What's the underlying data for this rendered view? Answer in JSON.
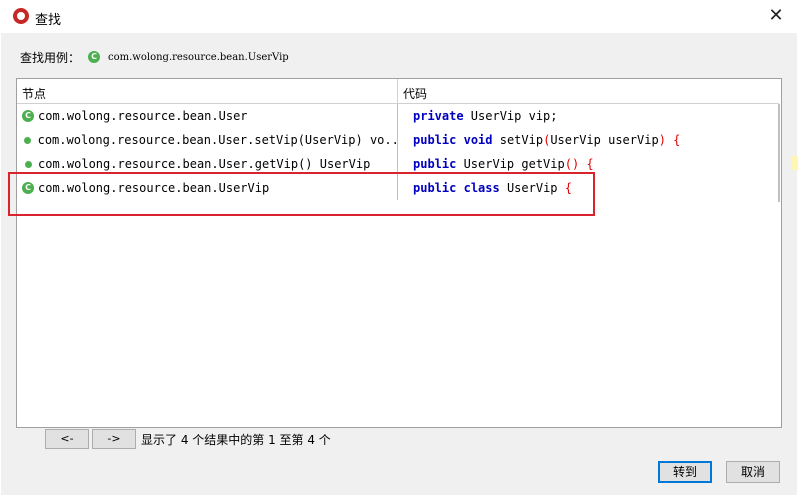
{
  "window": {
    "title": "查找",
    "close_glyph": "✕"
  },
  "search_case": {
    "label": "查找用例：",
    "icon": "class-icon",
    "value": "com.wolong.resource.bean.UserVip"
  },
  "table": {
    "headers": [
      "节点",
      "代码"
    ],
    "rows": [
      {
        "icon": "class-icon",
        "node": "com.wolong.resource.bean.User",
        "code": [
          {
            "t": "private",
            "c": "kw"
          },
          {
            "t": " UserVip vip;",
            "c": ""
          }
        ]
      },
      {
        "icon": "method-icon",
        "node": "com.wolong.resource.bean.User.setVip(UserVip) vo...",
        "code": [
          {
            "t": "public",
            "c": "kw"
          },
          {
            "t": " ",
            "c": ""
          },
          {
            "t": "void",
            "c": "kw"
          },
          {
            "t": " setVip",
            "c": ""
          },
          {
            "t": "(",
            "c": "red"
          },
          {
            "t": "UserVip userVip",
            "c": ""
          },
          {
            "t": ") {",
            "c": "red"
          }
        ]
      },
      {
        "icon": "method-icon",
        "node": "com.wolong.resource.bean.User.getVip() UserVip",
        "code": [
          {
            "t": "public",
            "c": "kw"
          },
          {
            "t": " UserVip getVip",
            "c": ""
          },
          {
            "t": "() {",
            "c": "red"
          }
        ]
      },
      {
        "icon": "class-icon",
        "node": "com.wolong.resource.bean.UserVip",
        "code": [
          {
            "t": "public",
            "c": "kw"
          },
          {
            "t": " ",
            "c": ""
          },
          {
            "t": "class",
            "c": "kw"
          },
          {
            "t": " UserVip ",
            "c": ""
          },
          {
            "t": "{",
            "c": "red"
          }
        ]
      }
    ]
  },
  "nav": {
    "prev_label": "<-",
    "next_label": "->",
    "status": "显示了 4 个结果中的第 1 至第 4 个"
  },
  "buttons": {
    "goto": "转到",
    "cancel": "取消"
  },
  "colors": {
    "keyword": "#0000c0",
    "bracket": "#e00000",
    "highlight": "#d9232d",
    "class_icon": "#4caf50"
  }
}
